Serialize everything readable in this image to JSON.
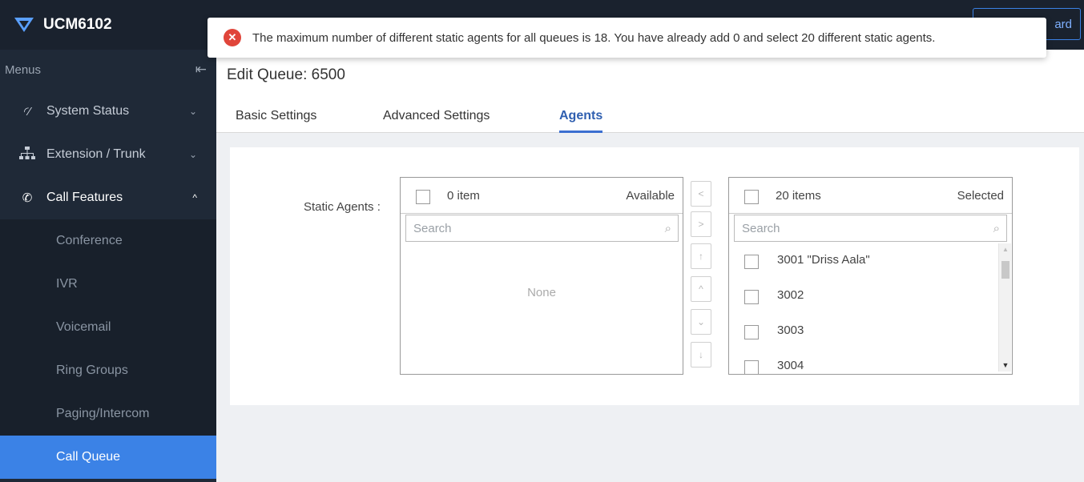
{
  "app": {
    "title": "UCM6102"
  },
  "sidebar": {
    "menus_label": "Menus",
    "items": [
      {
        "label": "System Status",
        "icon": "gauge-icon"
      },
      {
        "label": "Extension / Trunk",
        "icon": "network-icon"
      },
      {
        "label": "Call Features",
        "icon": "phone-icon"
      }
    ],
    "sub_items": [
      {
        "label": "Conference"
      },
      {
        "label": "IVR"
      },
      {
        "label": "Voicemail"
      },
      {
        "label": "Ring Groups"
      },
      {
        "label": "Paging/Intercom"
      },
      {
        "label": "Call Queue"
      }
    ],
    "active_sub_item": "Call Queue",
    "active_color": "#3b82e6"
  },
  "topbar": {
    "wizard_label": "ard"
  },
  "toast": {
    "message": "The maximum number of different static agents for all queues is 18. You have already add 0 and select 20 different static agents.",
    "icon": "error-icon",
    "icon_color": "#e0453a"
  },
  "page": {
    "title": "Edit Queue: 6500",
    "tabs": [
      {
        "label": "Basic Settings"
      },
      {
        "label": "Advanced Settings"
      },
      {
        "label": "Agents"
      }
    ],
    "active_tab": "Agents"
  },
  "static_agents": {
    "label": "Static Agents",
    "available": {
      "count_label": "0 item",
      "title": "Available",
      "search_placeholder": "Search",
      "empty_text": "None"
    },
    "selected": {
      "count_label": "20 items",
      "title": "Selected",
      "search_placeholder": "Search",
      "items": [
        "3001 \"Driss Aala\"",
        "3002",
        "3003",
        "3004"
      ]
    }
  }
}
